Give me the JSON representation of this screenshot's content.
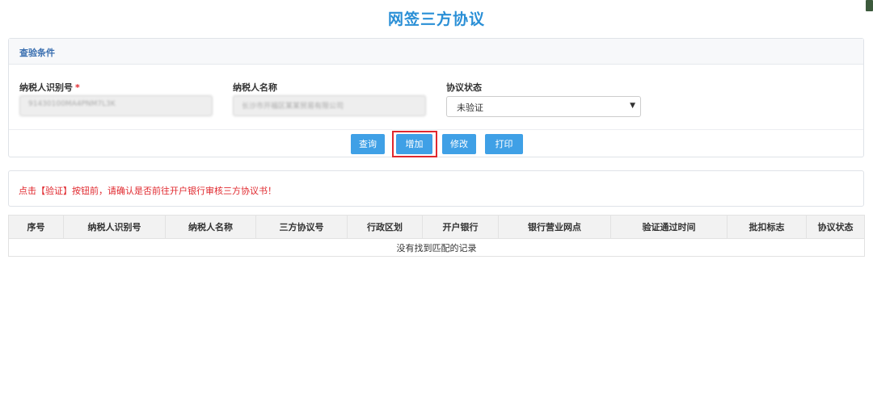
{
  "page": {
    "title": "网签三方协议"
  },
  "filter": {
    "section_title": "查验条件",
    "taxpayer_id_label": "纳税人识别号",
    "taxpayer_id_required": "*",
    "taxpayer_id_value": "91430100MA4PNM7L3K",
    "taxpayer_name_label": "纳税人名称",
    "taxpayer_name_value": "长沙市开福区某某贸易有限公司",
    "status_label": "协议状态",
    "status_value": "未验证"
  },
  "buttons": {
    "query": "查询",
    "add": "增加",
    "edit": "修改",
    "print": "打印"
  },
  "notice": {
    "text": "点击【验证】按钮前，请确认是否前往开户银行审核三方协议书！"
  },
  "table": {
    "headers": [
      "序号",
      "纳税人识别号",
      "纳税人名称",
      "三方协议号",
      "行政区划",
      "开户银行",
      "银行营业网点",
      "验证通过时间",
      "批扣标志",
      "协议状态"
    ],
    "empty_text": "没有找到匹配的记录"
  },
  "colors": {
    "accent": "#3fa0e6",
    "title": "#2a8fd6",
    "warning": "#e0282e"
  }
}
